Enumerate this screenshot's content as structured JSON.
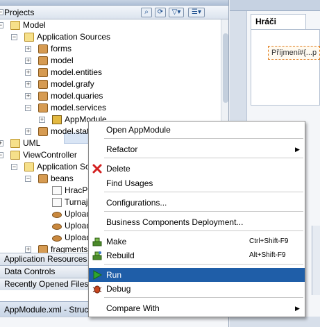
{
  "projects_panel": {
    "title": "Projects",
    "toolbar": [
      "binoculars-icon",
      "sync-icon",
      "filter-icon",
      "working-sets-icon"
    ]
  },
  "tree": {
    "model": "Model",
    "application_sources_1": "Application Sources",
    "forms": "forms",
    "model_pkg": "model",
    "model_entities": "model.entities",
    "model_grafy": "model.grafy",
    "model_quaries": "model.quaries",
    "model_services": "model.services",
    "appmodule": "AppModule",
    "model_statis": "model.statis",
    "uml": "UML",
    "viewcontroller": "ViewController",
    "application_sources_2": "Application Sou",
    "beans": "beans",
    "hracpr": "HracPr",
    "turnaj": "Turnajz",
    "upload1": "Upload",
    "upload2": "Upload",
    "upload3": "Upload",
    "fragments": "fragments"
  },
  "accordion": {
    "application_resources": "Application Resources",
    "data_controls": "Data Controls",
    "recently_opened_files": "Recently Opened Files"
  },
  "structure_tab": "AppModule.xml - Structu",
  "editor": {
    "tab_hraci": "Hráči",
    "field_label": "Příjmení",
    "field_value": "#{...p"
  },
  "context_menu": {
    "open": "Open AppModule",
    "refactor": "Refactor",
    "delete": "Delete",
    "find_usages": "Find Usages",
    "configurations": "Configurations...",
    "bc_deployment": "Business Components Deployment...",
    "make": "Make",
    "make_shortcut": "Ctrl+Shift-F9",
    "rebuild": "Rebuild",
    "rebuild_shortcut": "Alt+Shift-F9",
    "run": "Run",
    "debug": "Debug",
    "compare_with": "Compare With"
  },
  "colors": {
    "menu_highlight": "#1f5ea8",
    "delete_icon": "#d32020",
    "run_icon": "#2fa52f"
  }
}
